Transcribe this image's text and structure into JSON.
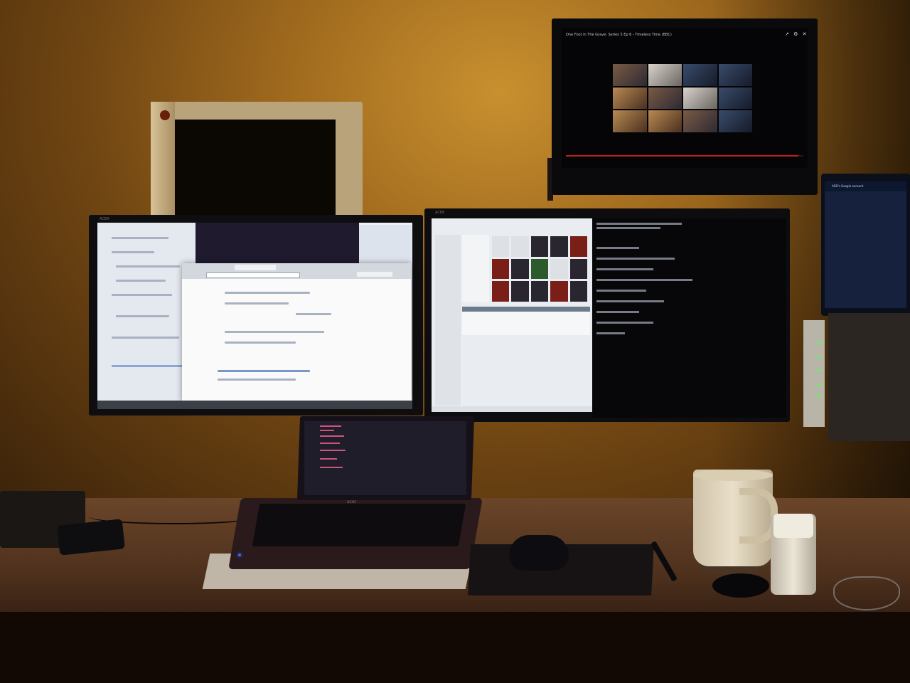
{
  "scene": {
    "kind": "photo-of-desk-setup",
    "lighting": "dim-warm",
    "colors": {
      "wall": "#a06a1e",
      "desk": "#5a3a22",
      "screen_light": "#eef1f6",
      "terminal": "#07070a",
      "led_green": "#59ff5a",
      "led_blue": "#3a68ff",
      "progress_red": "#c21f1f"
    }
  },
  "tv": {
    "title": "One Foot in The Grave: Series 5 Ep 6 - Timeless Time (BBC)",
    "controls_icons": "↗ ⚙ ✕",
    "progress": 0.98
  },
  "left_monitor": {
    "brand": "ACER"
  },
  "right_monitor": {
    "brand": "ACER"
  },
  "laptop": {
    "brand": "acer"
  },
  "tablet": {
    "title": "ARD's Google account"
  }
}
